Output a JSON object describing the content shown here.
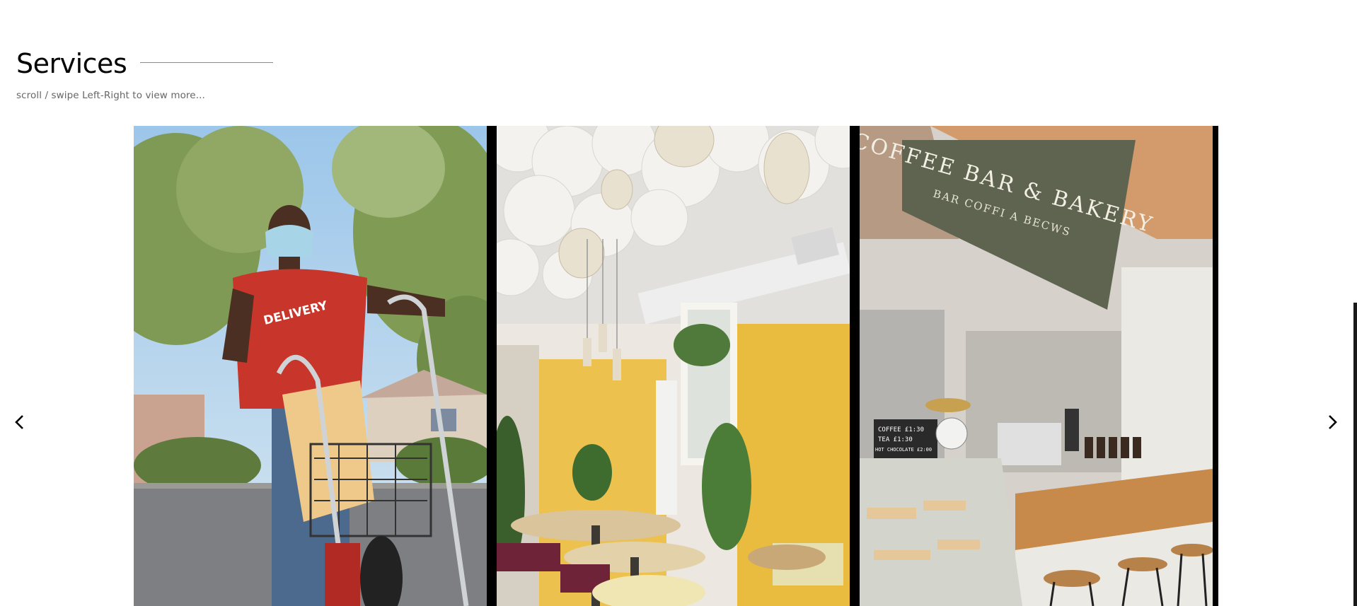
{
  "section": {
    "title": "Services",
    "hint": "scroll / swipe Left-Right to view more..."
  },
  "nav": {
    "prev_icon": "chevron-left-icon",
    "next_icon": "chevron-right-icon"
  },
  "slides": [
    {
      "name": "delivery",
      "shirt_text": "DELIVERY"
    },
    {
      "name": "restaurant-interior"
    },
    {
      "name": "coffee-bar",
      "sign_title": "COFFEE BAR & BAKERY",
      "sign_subtitle": "BAR COFFI A BECWS",
      "board_line_1": "COFFEE £1:30",
      "board_line_2": "TEA £1:30",
      "board_line_3": "HOT CHOCOLATE £2:00"
    }
  ],
  "colors": {
    "background": "#ffffff",
    "title": "#050505",
    "hint": "#666666",
    "slider_bg": "#000000"
  }
}
